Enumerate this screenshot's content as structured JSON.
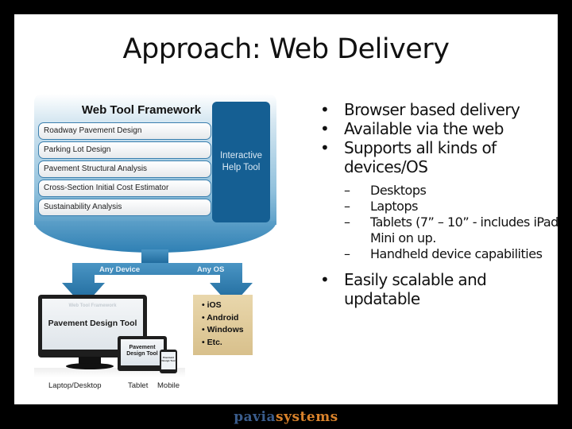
{
  "slide": {
    "title": "Approach: Web Delivery"
  },
  "diagram": {
    "framework_title": "Web Tool Framework",
    "modules": [
      "Roadway Pavement Design",
      "Parking Lot Design",
      "Pavement Structural Analysis",
      "Cross-Section Initial Cost Estimator",
      "Sustainability Analysis"
    ],
    "help_tool": "Interactive Help Tool",
    "arrow_left_label": "Any Device",
    "arrow_right_label": "Any OS",
    "os_list": [
      "iOS",
      "Android",
      "Windows",
      "Etc."
    ],
    "devices": {
      "monitor_screen_title": "Web Tool Framework",
      "monitor_screen_text": "Pavement Design Tool",
      "tablet_screen_text": "Pavement Design Tool",
      "phone_screen_text": "Pavement Design Tool",
      "labels": [
        "Laptop/Desktop",
        "Tablet",
        "Mobile"
      ]
    },
    "colors": {
      "arrow_blue": "#1f6fa3",
      "help_tool_blue": "#155f93",
      "os_box_tan": "#dfc895"
    }
  },
  "bullets": [
    {
      "text": "Browser based delivery"
    },
    {
      "text": "Available via the web"
    },
    {
      "text": "Supports all kinds of devices/OS",
      "sub": [
        "Desktops",
        "Laptops",
        "Tablets  (7” – 10” - includes iPad Mini on up.",
        "Handheld device capabilities"
      ]
    },
    {
      "text": "Easily scalable and updatable"
    }
  ],
  "bullet_glyph": "•",
  "dash_glyph": "–",
  "footer": {
    "logo_part1": "pavia",
    "logo_part2": "systems",
    "logo_color1": "#3a5c8c",
    "logo_color2": "#d9822b"
  }
}
